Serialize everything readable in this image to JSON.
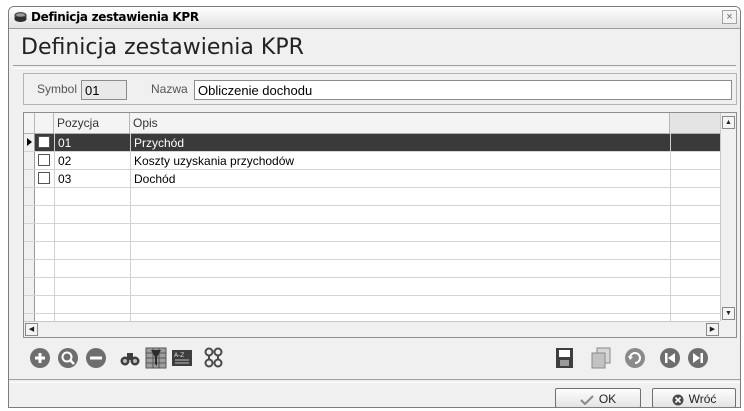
{
  "window": {
    "title": "Definicja zestawienia KPR",
    "heading": "Definicja zestawienia KPR",
    "close_glyph": "×"
  },
  "header": {
    "symbol_label": "Symbol",
    "symbol_value": "01",
    "name_label": "Nazwa",
    "name_value": "Obliczenie dochodu"
  },
  "grid": {
    "columns": [
      "Pozycja",
      "Opis"
    ],
    "rows": [
      {
        "pozycja": "01",
        "opis": "Przychód",
        "selected": true
      },
      {
        "pozycja": "02",
        "opis": "Koszty uzyskania przychodów",
        "selected": false
      },
      {
        "pozycja": "03",
        "opis": "Dochód",
        "selected": false
      }
    ],
    "total_rows": 11
  },
  "toolbar": {
    "left_icons": [
      "add-icon",
      "edit-icon",
      "delete-icon",
      "search-icon",
      "filter-icon",
      "sort-icon",
      "group-icon"
    ],
    "right_icons": [
      "save-icon",
      "copy-icon",
      "refresh-icon",
      "first-icon",
      "last-icon"
    ]
  },
  "buttons": {
    "ok_label": "OK",
    "back_label": "Wróć"
  },
  "colors": {
    "selected_row": "#3a3a3a",
    "icon_gray": "#6e6e6e"
  }
}
